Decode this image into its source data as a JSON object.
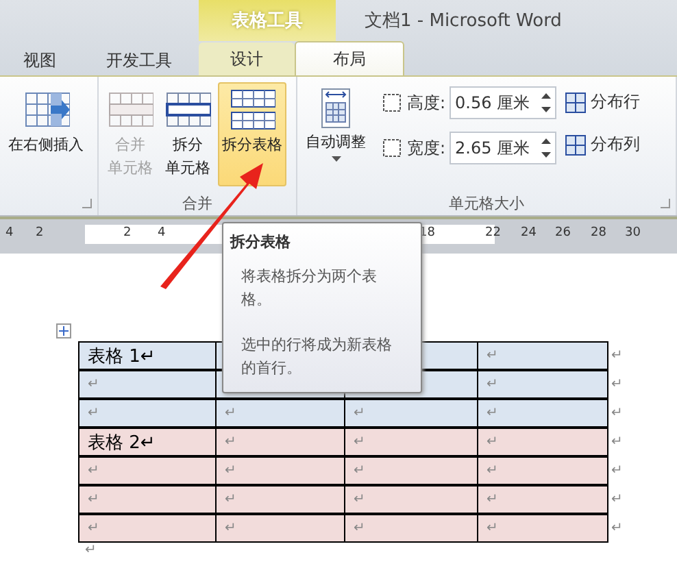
{
  "context_tab": {
    "label": "表格工具"
  },
  "window": {
    "title": "文档1  -  Microsoft Word"
  },
  "tabs": [
    {
      "label": "视图",
      "selected": false,
      "contextual": false
    },
    {
      "label": "开发工具",
      "selected": false,
      "contextual": false
    },
    {
      "label": "设计",
      "selected": false,
      "contextual": true
    },
    {
      "label": "布局",
      "selected": true,
      "contextual": true
    }
  ],
  "ribbon": {
    "groups": [
      {
        "launcher": true,
        "items": [
          {
            "kind": "big",
            "lines": [
              "在右侧插入"
            ],
            "disabled": false,
            "highlighted": false
          }
        ]
      },
      {
        "label": "合并",
        "launcher": false,
        "items": [
          {
            "kind": "big",
            "lines": [
              "合并",
              "单元格"
            ],
            "disabled": true,
            "highlighted": false
          },
          {
            "kind": "big",
            "lines": [
              "拆分",
              "单元格"
            ],
            "disabled": false,
            "highlighted": false
          },
          {
            "kind": "big",
            "lines": [
              "拆分表格"
            ],
            "disabled": false,
            "highlighted": true
          }
        ]
      },
      {
        "label": "单元格大小",
        "launcher": true,
        "items": [
          {
            "kind": "dropdown",
            "lines": [
              "自动调整"
            ],
            "disabled": false,
            "highlighted": false
          },
          {
            "kind": "spinners",
            "fields": [
              {
                "label": "高度:",
                "value": "0.56 厘米"
              },
              {
                "label": "宽度:",
                "value": "2.65 厘米"
              }
            ]
          },
          {
            "kind": "small",
            "buttons": [
              {
                "label": "分布行"
              },
              {
                "label": "分布列"
              }
            ]
          }
        ]
      }
    ]
  },
  "ruler": {
    "numbers": [
      "4",
      "2",
      "2",
      "4",
      "18",
      "22",
      "24",
      "26",
      "28",
      "30"
    ]
  },
  "tooltip": {
    "title": "拆分表格",
    "paragraphs": [
      "将表格拆分为两个表格。",
      "选中的行将成为新表格的首行。"
    ]
  },
  "table": {
    "rows": [
      {
        "color": "#dbe5f1",
        "cells": [
          {
            "text": "表格 1↵",
            "kind": "label"
          },
          {},
          {},
          {
            "text": "↵"
          }
        ],
        "end": "↵"
      },
      {
        "color": "#dbe5f1",
        "cells": [
          {
            "text": "↵"
          },
          {},
          {},
          {
            "text": "↵"
          }
        ],
        "end": "↵"
      },
      {
        "color": "#dbe5f1",
        "cells": [
          {
            "text": "↵"
          },
          {
            "text": "↵"
          },
          {
            "text": "↵"
          },
          {
            "text": "↵"
          }
        ],
        "end": "↵"
      },
      {
        "color": "#f2dcdb",
        "cells": [
          {
            "text": "表格 2↵",
            "kind": "label"
          },
          {
            "text": "↵"
          },
          {
            "text": "↵"
          },
          {
            "text": "↵"
          }
        ],
        "end": "↵"
      },
      {
        "color": "#f2dcdb",
        "cells": [
          {
            "text": "↵"
          },
          {
            "text": "↵"
          },
          {
            "text": "↵"
          },
          {
            "text": "↵"
          }
        ],
        "end": "↵"
      },
      {
        "color": "#f2dcdb",
        "cells": [
          {
            "text": "↵"
          },
          {
            "text": "↵"
          },
          {
            "text": "↵"
          },
          {
            "text": "↵"
          }
        ],
        "end": "↵"
      },
      {
        "color": "#f2dcdb",
        "cells": [
          {
            "text": "↵"
          },
          {
            "text": "↵"
          },
          {
            "text": "↵"
          },
          {
            "text": "↵"
          }
        ],
        "end": "↵"
      }
    ],
    "after": "↵"
  }
}
